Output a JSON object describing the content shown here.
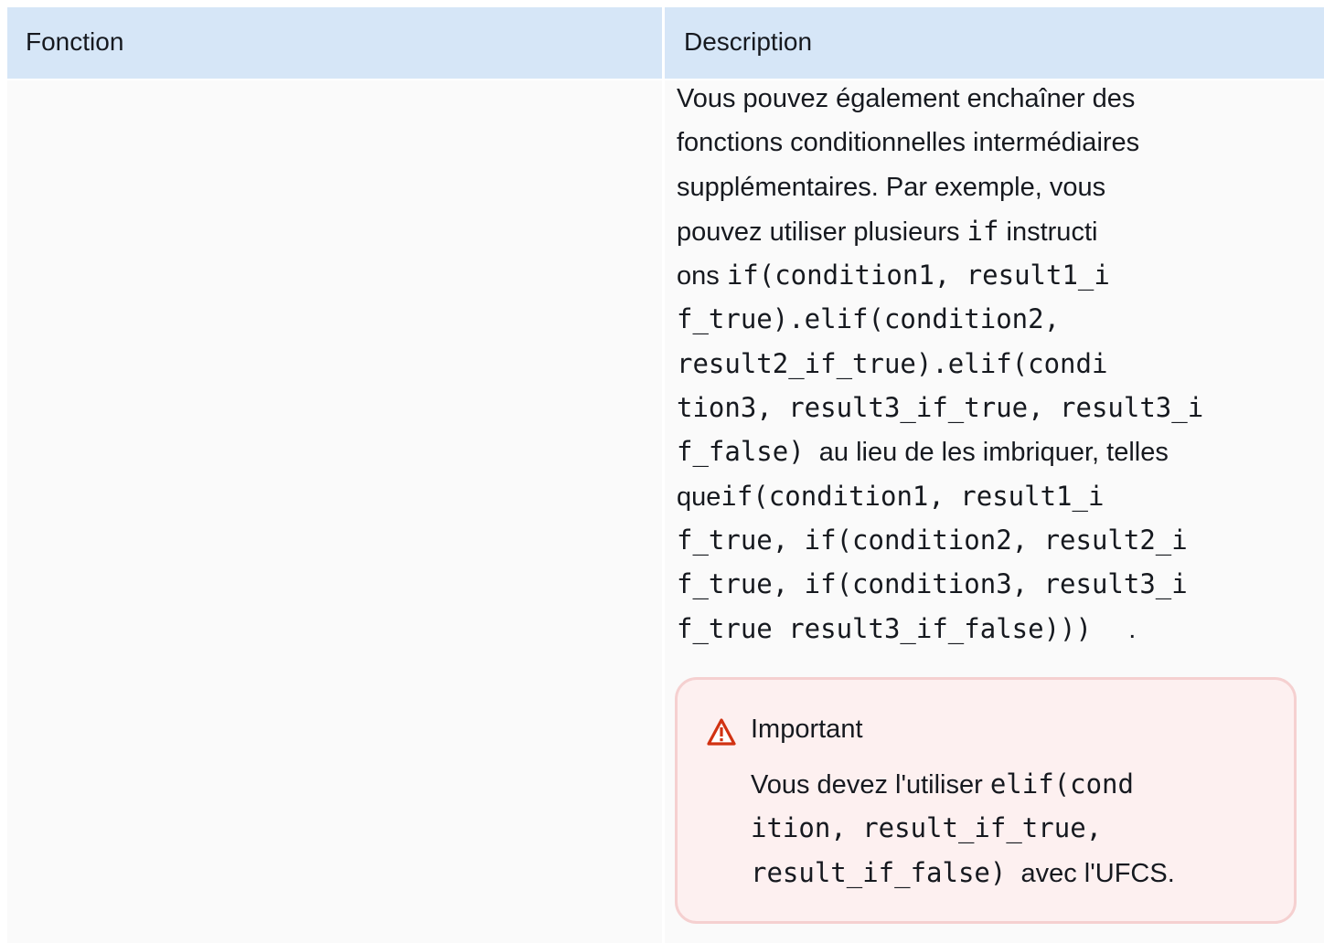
{
  "table": {
    "headers": {
      "fonction": "Fonction",
      "description": "Description"
    },
    "description_cell": {
      "lines": [
        [
          {
            "t": "Vous pouvez également enchaîner des"
          }
        ],
        [
          {
            "t": "fonctions conditionnelles intermédiaires"
          }
        ],
        [
          {
            "t": "supplémentaires. Par exemple, vous"
          }
        ],
        [
          {
            "t": "pouvez utiliser plusieurs "
          },
          {
            "c": "if"
          },
          {
            "t": " instructi"
          }
        ],
        [
          {
            "t": "ons "
          },
          {
            "c": "if(condition1, result1_i"
          }
        ],
        [
          {
            "c": "f_true).elif(condition2,"
          }
        ],
        [
          {
            "c": "result2_if_true).elif(condi"
          }
        ],
        [
          {
            "c": "tion3, result3_if_true, result3_i"
          }
        ],
        [
          {
            "c": "f_false)"
          },
          {
            "t": "  au lieu de les imbriquer, telles"
          }
        ],
        [
          {
            "t": "que"
          },
          {
            "c": "if(condition1, result1_i"
          }
        ],
        [
          {
            "c": "f_true, if(condition2, result2_i"
          }
        ],
        [
          {
            "c": "f_true, if(condition3, result3_i"
          }
        ],
        [
          {
            "c": "f_true result3_if_false)))"
          },
          {
            "t": "     ."
          }
        ]
      ]
    },
    "callout": {
      "icon": "warning-icon",
      "accent_color": "#d13212",
      "title": "Important",
      "lines": [
        [
          {
            "t": "Vous devez l'utiliser "
          },
          {
            "c": "elif(cond"
          }
        ],
        [
          {
            "c": "ition, result_if_true,"
          }
        ],
        [
          {
            "c": "result_if_false)"
          },
          {
            "t": "  avec l'UFCS."
          }
        ]
      ]
    }
  }
}
